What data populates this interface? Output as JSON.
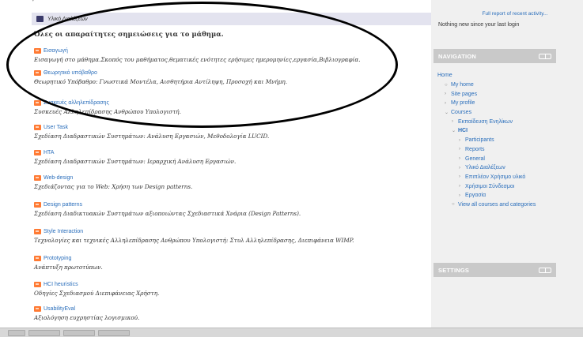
{
  "section": {
    "title": "Υλικό Διαλέξεων",
    "summary": "Όλες οι απαραίτητες σημειώσεις για το μάθημα."
  },
  "activities": [
    {
      "link": "Εισαγωγή",
      "desc": "Εισαγωγή στο μάθημα.Σκοπός του μαθήματος,θεματικές ενότητες ερήσιμες ημερομηνίες,εργασία,Βιβλιογραφία."
    },
    {
      "link": "Θεωρητικό υπόβαθρο",
      "desc": "Θεωρητικό Υπόβαθρο: Γνωστικά Μοντέλα, Αισθητήρια Αντίληψη, Προσοχή και Μνήμη."
    },
    {
      "link": "Συσκευές αλληλεπίδρασης",
      "desc": "Συσκευές Αλληλεπίδρασης Ανθρώπου Υπολογιστή."
    },
    {
      "link": "User Task",
      "desc": "Σχεδίαση Διαδραστικών Συστημάτων: Ανάλυση Εργασιών, Μεθοδολογία LUCID."
    },
    {
      "link": "HTA",
      "desc": "Σχεδίαση Διαδραστικών Συστημάτων: Ιεραρχική Ανάλυση Εργασιών."
    },
    {
      "link": "Web-design",
      "desc": "Σχεδιάζοντας για το Web: Χρήση των Design patterns."
    },
    {
      "link": "Design patterns",
      "desc": "Σχεδίαση Διαδικτυακών Συστημάτων αξιοποιώντας Σχεδιαστικά Χνάρια (Design Patterns)."
    },
    {
      "link": "Style Interaction",
      "desc": "Τεχνολογίες και τεχνικές Αλληλεπίδρασης Ανθρώπου Υπολογιστή: Στυλ Αλληλεπίδρασης, Διεπιφάνεια WIMP."
    },
    {
      "link": "Prototyping",
      "desc": "Ανάπτυξη πρωτοτύπων."
    },
    {
      "link": "HCI heuristics",
      "desc": "Οδηγίες Σχεδιασμού Διεπιφάνειας Χρήστη."
    },
    {
      "link": "UsabilityEval",
      "desc": "Αξιολόγηση ευχρηστίας λογισμικού."
    }
  ],
  "sidebar": {
    "recent_full_link": "Full report of recent activity...",
    "recent_nothing": "Nothing new since your last login",
    "navigation_title": "NAVIGATION",
    "settings_title": "SETTINGS",
    "nav": [
      {
        "label": "Home",
        "bullet": "",
        "indent": 0,
        "style": "plain"
      },
      {
        "label": "My home",
        "bullet": "○",
        "indent": 1,
        "style": "plain"
      },
      {
        "label": "Site pages",
        "bullet": "›",
        "indent": 1,
        "style": "plain"
      },
      {
        "label": "My profile",
        "bullet": "›",
        "indent": 1,
        "style": "plain"
      },
      {
        "label": "Courses",
        "bullet": "⌄",
        "indent": 1,
        "style": "plain"
      },
      {
        "label": "Εκπαίδευση Ενηλίκων",
        "bullet": "›",
        "indent": 2,
        "style": "plain"
      },
      {
        "label": "HCI",
        "bullet": "⌄",
        "indent": 2,
        "style": "bold"
      },
      {
        "label": "Participants",
        "bullet": "›",
        "indent": 3,
        "style": "plain"
      },
      {
        "label": "Reports",
        "bullet": "›",
        "indent": 3,
        "style": "plain"
      },
      {
        "label": "General",
        "bullet": "›",
        "indent": 3,
        "style": "plain"
      },
      {
        "label": "Υλικό Διαλέξεων",
        "bullet": "›",
        "indent": 3,
        "style": "plain"
      },
      {
        "label": "Επιπλέον Χρήσιμο υλικό",
        "bullet": "›",
        "indent": 3,
        "style": "plain"
      },
      {
        "label": "Χρήσιμοι Σύνδεσμοι",
        "bullet": "›",
        "indent": 3,
        "style": "plain"
      },
      {
        "label": "Εργασία",
        "bullet": "›",
        "indent": 3,
        "style": "plain"
      },
      {
        "label": "View all courses and categories",
        "bullet": "○",
        "indent": 2,
        "style": "plain"
      }
    ]
  },
  "colors": {
    "link": "#2a6ebb",
    "section_bar": "#e3e3ef",
    "block_header": "#c9c9c9",
    "activity_icon": "#ff7a33"
  }
}
